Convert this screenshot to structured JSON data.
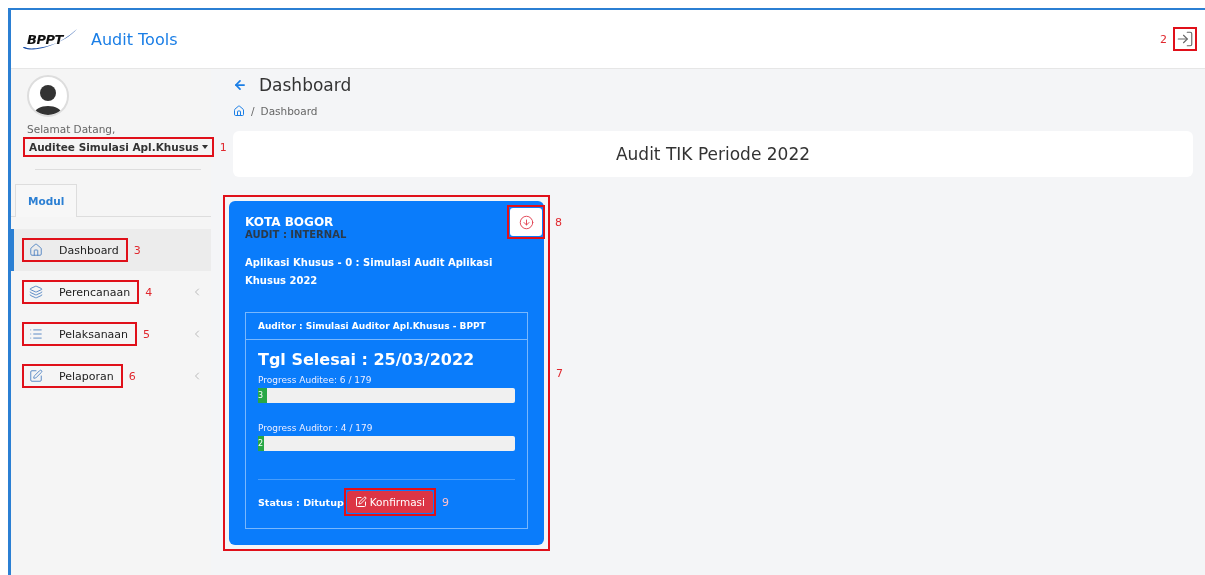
{
  "header": {
    "logo_text": "BPPT",
    "app_name": "Audit Tools",
    "logout_callout": "2"
  },
  "sidebar": {
    "greeting": "Selamat Datang,",
    "user": {
      "name": "Auditee Simulasi Apl.Khusus",
      "callout": "1"
    },
    "tabs": [
      {
        "label": "Modul",
        "selected": true
      }
    ],
    "menu": [
      {
        "label": "Dashboard",
        "selected": true,
        "has_children": false,
        "callout": "3"
      },
      {
        "label": "Perencanaan",
        "selected": false,
        "has_children": true,
        "callout": "4"
      },
      {
        "label": "Pelaksanaan",
        "selected": false,
        "has_children": true,
        "callout": "5"
      },
      {
        "label": "Pelaporan",
        "selected": false,
        "has_children": true,
        "callout": "6"
      }
    ]
  },
  "page": {
    "title": "Dashboard",
    "breadcrumb": [
      {
        "separator": "/",
        "label": "Dashboard"
      }
    ],
    "banner": "Audit TIK Periode 2022",
    "cards": [
      {
        "callout": "7",
        "city": "KOTA BOGOR",
        "audit_type": "AUDIT : INTERNAL",
        "download_callout": "8",
        "description": "Aplikasi Khusus - 0 : Simulasi Audit Aplikasi Khusus 2022",
        "auditor": "Auditor : Simulasi Auditor Apl.Khusus - BPPT",
        "end_date": "Tgl Selesai : 25/03/2022",
        "progress": [
          {
            "label": "Progress Auditee: 6 / 179",
            "level": 0.034,
            "fill_text": "3"
          },
          {
            "label": "Progress Auditor : 4 / 179",
            "level": 0.022,
            "fill_text": "2"
          }
        ],
        "status": "Status : Ditutup",
        "button": {
          "label": "Konfirmasi",
          "callout": "9"
        }
      }
    ]
  }
}
